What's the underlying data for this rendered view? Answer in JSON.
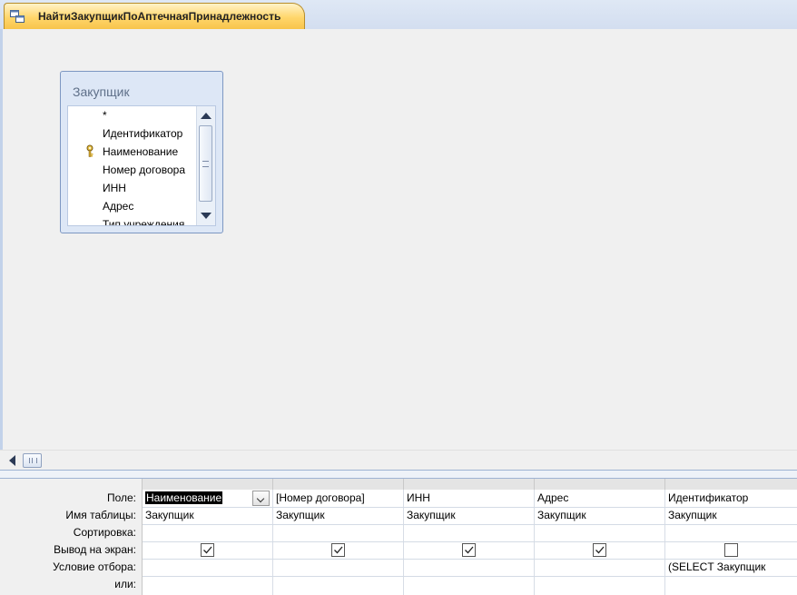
{
  "tab": {
    "title": "НайтиЗакупщикПоАптечнаяПринадлежность"
  },
  "field_list": {
    "title": "Закупщик",
    "items": [
      "*",
      "Идентификатор",
      "Наименование",
      "Номер договора",
      "ИНН",
      "Адрес",
      "Тип учреждения"
    ],
    "primary_key": "Идентификатор"
  },
  "grid": {
    "row_labels": [
      "Поле:",
      "Имя таблицы:",
      "Сортировка:",
      "Вывод на экран:",
      "Условие отбора:",
      "или:"
    ],
    "columns": [
      {
        "field": "Наименование",
        "table": "Закупщик",
        "sort": "",
        "show": true,
        "criteria": ""
      },
      {
        "field": "[Номер договора]",
        "table": "Закупщик",
        "sort": "",
        "show": true,
        "criteria": ""
      },
      {
        "field": "ИНН",
        "table": "Закупщик",
        "sort": "",
        "show": true,
        "criteria": ""
      },
      {
        "field": "Адрес",
        "table": "Закупщик",
        "sort": "",
        "show": true,
        "criteria": ""
      },
      {
        "field": "Идентификатор",
        "table": "Закупщик",
        "sort": "",
        "show": false,
        "criteria": "(SELECT Закупщик"
      }
    ]
  },
  "colors": {
    "tab_active": "#ffd66b",
    "selection": "#000000",
    "accent": "#7d97c2"
  }
}
